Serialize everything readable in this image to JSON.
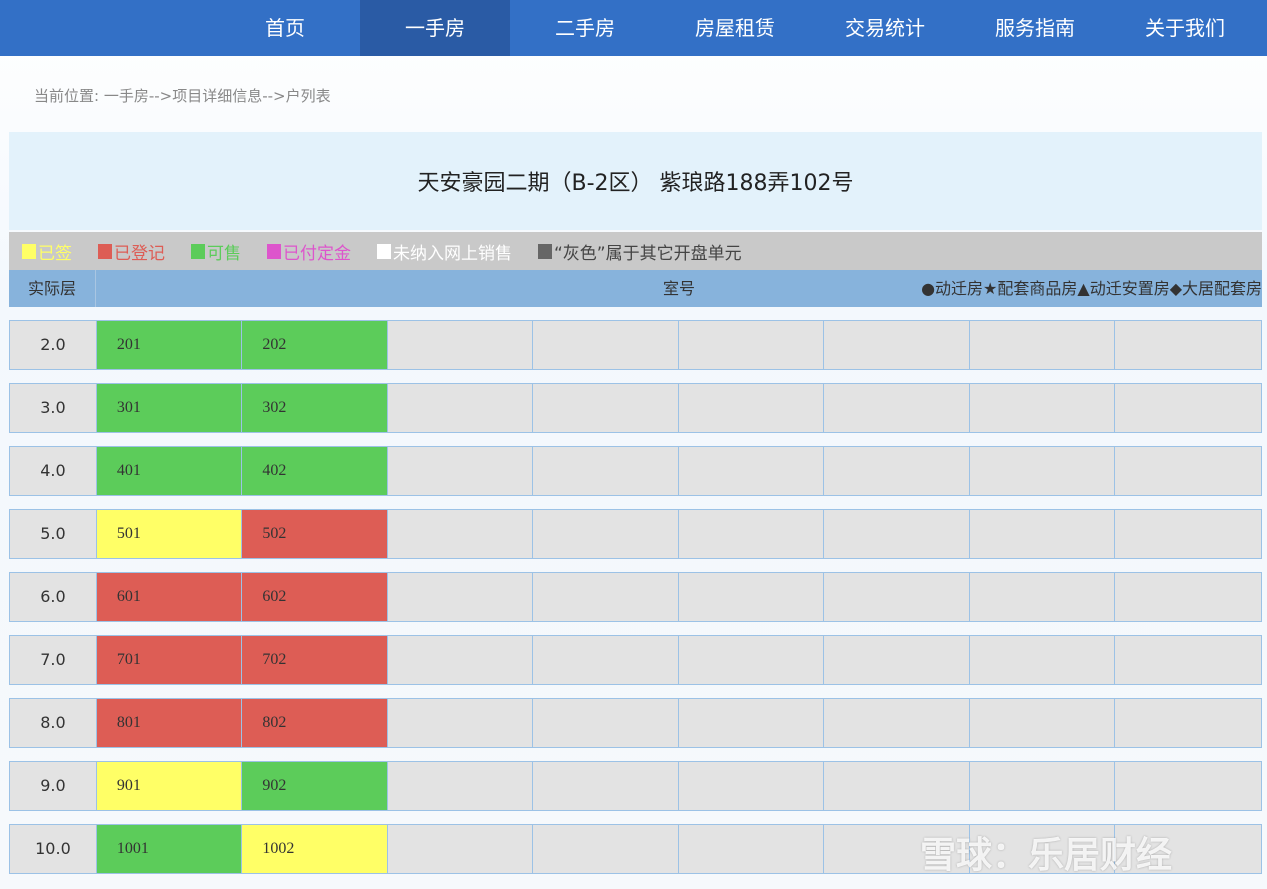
{
  "nav": {
    "items": [
      "首页",
      "一手房",
      "二手房",
      "房屋租赁",
      "交易统计",
      "服务指南",
      "关于我们"
    ],
    "active": 1
  },
  "breadcrumb": "当前位置: 一手房-->项目详细信息-->户列表",
  "title": "天安豪园二期（B-2区） 紫琅路188弄102号",
  "legend": [
    {
      "label": "已签",
      "color": "#ffff66"
    },
    {
      "label": "已登记",
      "color": "#dd5d55"
    },
    {
      "label": "可售",
      "color": "#5ccc5a"
    },
    {
      "label": "已付定金",
      "color": "#dd55cc"
    },
    {
      "label": "未纳入网上销售",
      "color": "#ffffff"
    },
    {
      "label": "“灰色”属于其它开盘单元",
      "color": "#666666"
    }
  ],
  "header": {
    "floor": "实际层",
    "room": "室号",
    "marks": "●动迁房★配套商品房▲动迁安置房◆大居配套房"
  },
  "rows": [
    {
      "floor": "2.0",
      "units": [
        {
          "no": "201",
          "status": "可售"
        },
        {
          "no": "202",
          "status": "可售"
        }
      ]
    },
    {
      "floor": "3.0",
      "units": [
        {
          "no": "301",
          "status": "可售"
        },
        {
          "no": "302",
          "status": "可售"
        }
      ]
    },
    {
      "floor": "4.0",
      "units": [
        {
          "no": "401",
          "status": "可售"
        },
        {
          "no": "402",
          "status": "可售"
        }
      ]
    },
    {
      "floor": "5.0",
      "units": [
        {
          "no": "501",
          "status": "已签"
        },
        {
          "no": "502",
          "status": "已登记"
        }
      ]
    },
    {
      "floor": "6.0",
      "units": [
        {
          "no": "601",
          "status": "已登记"
        },
        {
          "no": "602",
          "status": "已登记"
        }
      ]
    },
    {
      "floor": "7.0",
      "units": [
        {
          "no": "701",
          "status": "已登记"
        },
        {
          "no": "702",
          "status": "已登记"
        }
      ]
    },
    {
      "floor": "8.0",
      "units": [
        {
          "no": "801",
          "status": "已登记"
        },
        {
          "no": "802",
          "status": "已登记"
        }
      ]
    },
    {
      "floor": "9.0",
      "units": [
        {
          "no": "901",
          "status": "已签"
        },
        {
          "no": "902",
          "status": "可售"
        }
      ]
    },
    {
      "floor": "10.0",
      "units": [
        {
          "no": "1001",
          "status": "可售"
        },
        {
          "no": "1002",
          "status": "已签"
        }
      ]
    }
  ],
  "watermark": "雪球：乐居财经"
}
